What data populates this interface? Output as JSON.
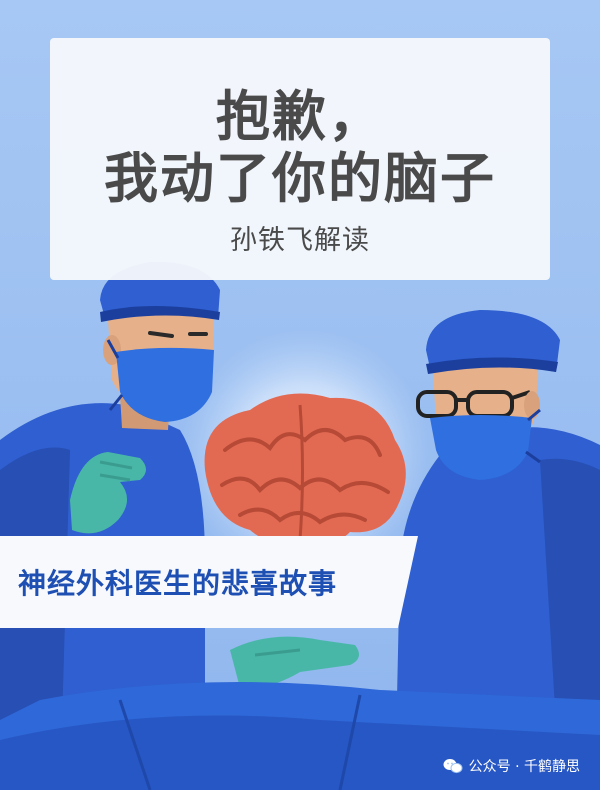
{
  "title": {
    "line1": "抱歉，",
    "line2": "我动了你的脑子",
    "byline": "孙铁飞解读"
  },
  "subtitle": "神经外科医生的悲喜故事",
  "watermark": {
    "text": "公众号 · 千鹤静思",
    "icon": "wechat-icon"
  },
  "colors": {
    "background": "#9cc1f2",
    "scrubs": "#2f5fd0",
    "scrubs_dark": "#1c3f9e",
    "gloves": "#49b7a8",
    "brain": "#e26a52",
    "subtitle_text": "#1e4fb3",
    "title_text": "#4a4a4a"
  }
}
